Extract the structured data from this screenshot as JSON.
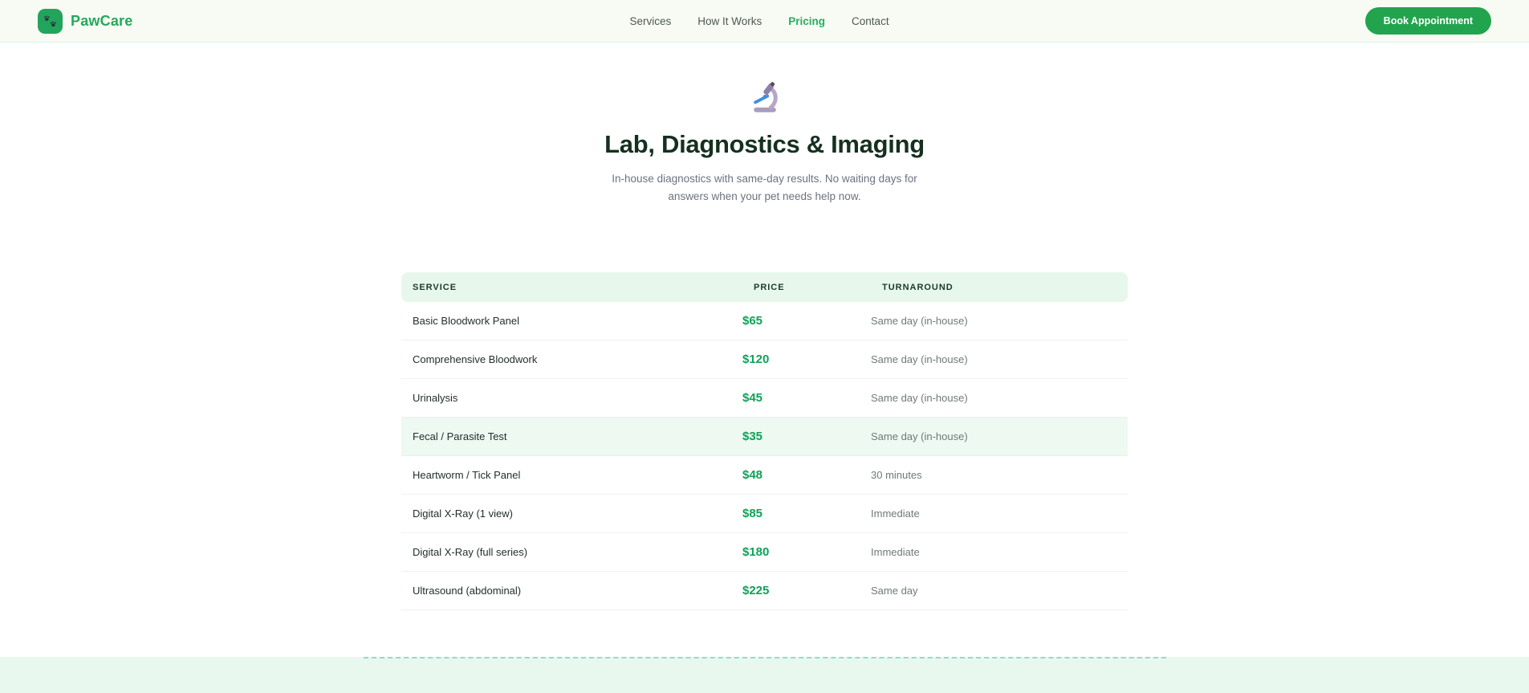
{
  "brand": {
    "name": "PawCare",
    "logo_icon": "paw-icon"
  },
  "nav": {
    "items": [
      {
        "label": "Services",
        "active": false
      },
      {
        "label": "How It Works",
        "active": false
      },
      {
        "label": "Pricing",
        "active": true
      },
      {
        "label": "Contact",
        "active": false
      }
    ],
    "cta_label": "Book Appointment"
  },
  "hero": {
    "icon": "microscope-icon",
    "title": "Lab, Diagnostics & Imaging",
    "subtitle": "In-house diagnostics with same-day results. No waiting days for answers when your pet needs help now."
  },
  "pricing_table": {
    "columns": [
      "SERVICE",
      "PRICE",
      "TURNAROUND"
    ],
    "rows": [
      {
        "service": "Basic Bloodwork Panel",
        "price": "$65",
        "turnaround": "Same day (in-house)",
        "highlighted": false
      },
      {
        "service": "Comprehensive Bloodwork",
        "price": "$120",
        "turnaround": "Same day (in-house)",
        "highlighted": false
      },
      {
        "service": "Urinalysis",
        "price": "$45",
        "turnaround": "Same day (in-house)",
        "highlighted": false
      },
      {
        "service": "Fecal / Parasite Test",
        "price": "$35",
        "turnaround": "Same day (in-house)",
        "highlighted": true
      },
      {
        "service": "Heartworm / Tick Panel",
        "price": "$48",
        "turnaround": "30 minutes",
        "highlighted": false
      },
      {
        "service": "Digital X-Ray (1 view)",
        "price": "$85",
        "turnaround": "Immediate",
        "highlighted": false
      },
      {
        "service": "Digital X-Ray (full series)",
        "price": "$180",
        "turnaround": "Immediate",
        "highlighted": false
      },
      {
        "service": "Ultrasound (abdominal)",
        "price": "$225",
        "turnaround": "Same day",
        "highlighted": false
      }
    ]
  },
  "colors": {
    "accent_green": "#22a45c",
    "price_green": "#0fa257",
    "header_bg": "#f8faf4",
    "table_header_bg": "#e7f7ec",
    "highlight_row_bg": "#edf9f1",
    "footer_bg": "#e9f8ee",
    "footer_dash": "#8edec6",
    "title_color": "#15301f",
    "muted_text": "#6b7280"
  }
}
